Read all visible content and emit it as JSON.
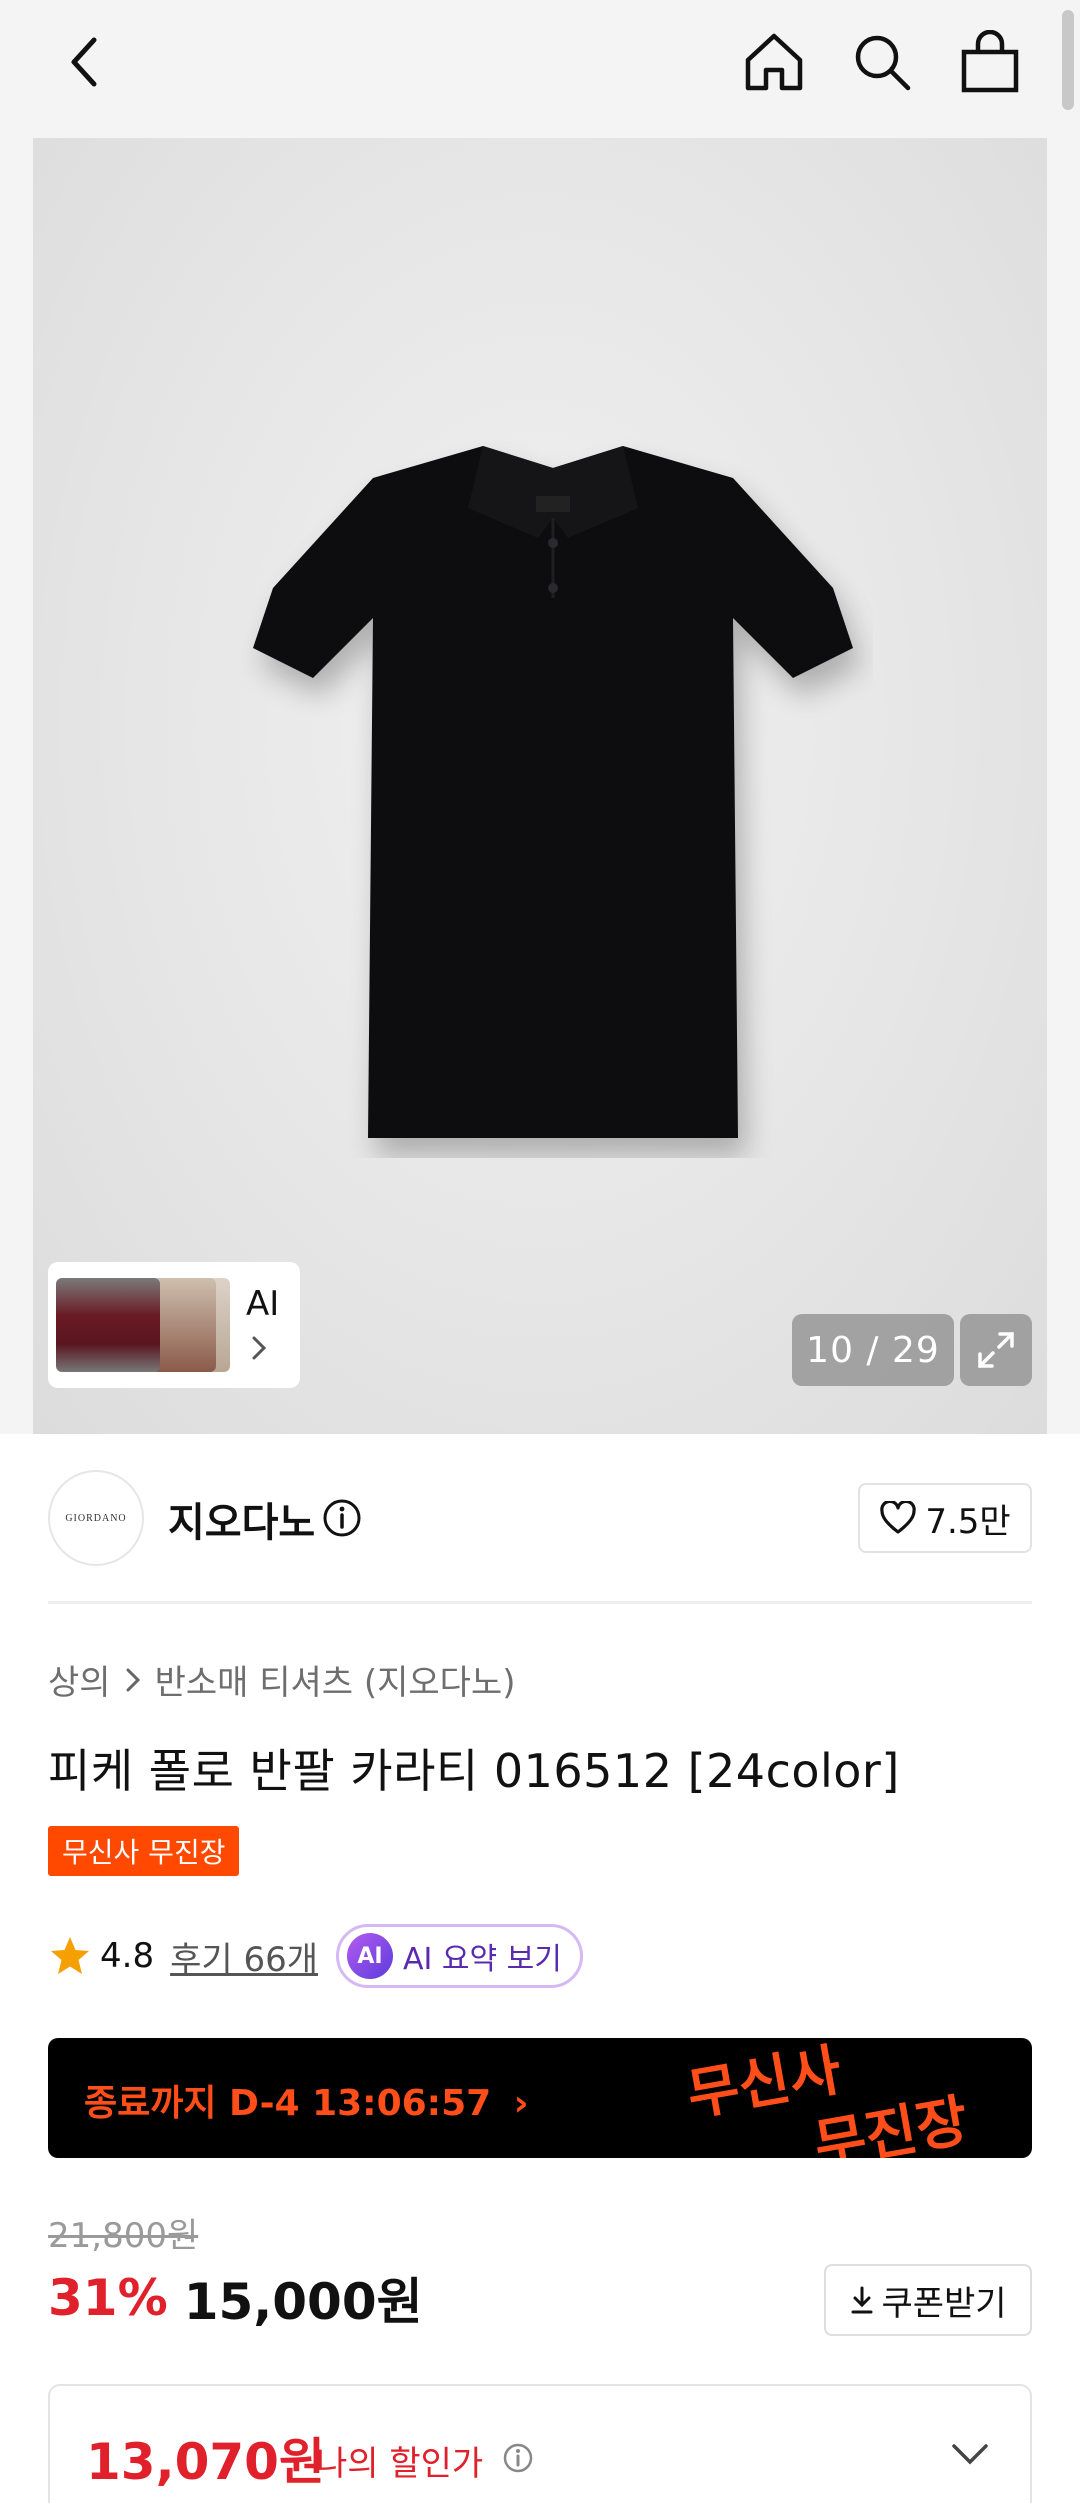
{
  "topbar": {
    "back_icon": "back-chevron-icon",
    "home_icon": "home-icon",
    "search_icon": "search-icon",
    "cart_icon": "shopping-bag-icon"
  },
  "gallery": {
    "ai_label": "AI",
    "counter": "10 / 29",
    "current_index": 10,
    "total_images": 29
  },
  "brand": {
    "logo_text": "GIORDANO",
    "name": "지오다노",
    "like_count": "7.5만"
  },
  "product": {
    "breadcrumb": [
      "상의",
      "반소매 티셔츠 (지오다노)"
    ],
    "title": "피케 폴로 반팔 카라티 016512 [24color]",
    "badge": "무신사 무진장",
    "rating": "4.8",
    "reviews": "후기 66개",
    "ai_summary_icon": "AI",
    "ai_summary": "AI 요약 보기"
  },
  "banner": {
    "countdown": "종료까지 D-4 13:06:57",
    "logo_line1": "무신사",
    "logo_line2": "무진장"
  },
  "price": {
    "original": "21,800원",
    "discount": "31%",
    "sale": "15,000원",
    "coupon": "쿠폰받기",
    "my_price": "13,070원",
    "my_price_label": "나의 할인가"
  },
  "colors": {
    "accent_orange": "#ff4800",
    "price_red": "#e0202a",
    "ai_purple": "#5a2ab0"
  }
}
